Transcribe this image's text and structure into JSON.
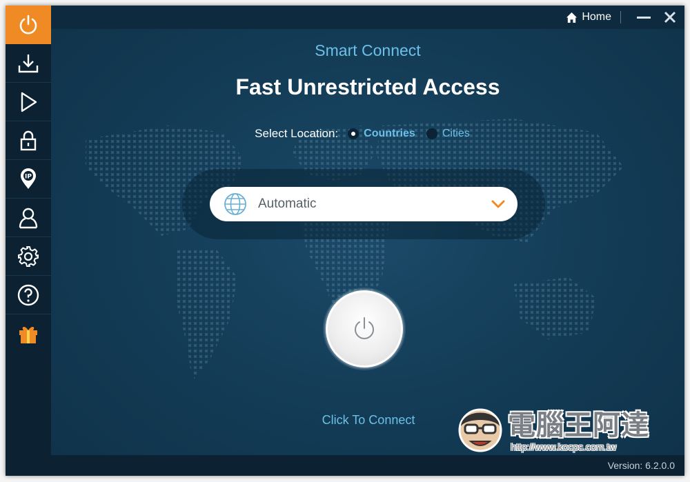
{
  "titlebar": {
    "home_label": "Home"
  },
  "sidebar": {
    "items": [
      {
        "name": "power-icon",
        "active": true
      },
      {
        "name": "download-icon",
        "active": false
      },
      {
        "name": "play-icon",
        "active": false
      },
      {
        "name": "lock-icon",
        "active": false
      },
      {
        "name": "ip-pin-icon",
        "active": false
      },
      {
        "name": "user-icon",
        "active": false
      },
      {
        "name": "gear-icon",
        "active": false
      },
      {
        "name": "help-icon",
        "active": false
      },
      {
        "name": "gift-icon",
        "active": false
      }
    ]
  },
  "main": {
    "subtitle": "Smart Connect",
    "title": "Fast Unrestricted Access",
    "location": {
      "label": "Select Location:",
      "options": [
        "Countries",
        "Cities"
      ],
      "selected": "Countries"
    },
    "select": {
      "value": "Automatic"
    },
    "connect_text": "Click To Connect"
  },
  "footer": {
    "version": "Version:  6.2.0.0"
  },
  "watermark": {
    "text": "電腦王阿達",
    "url": "http://www.kocpc.com.tw"
  },
  "colors": {
    "accent": "#f08a24",
    "link": "#6cc0e8",
    "background": "#11334a",
    "sidebar": "#0c2233"
  }
}
